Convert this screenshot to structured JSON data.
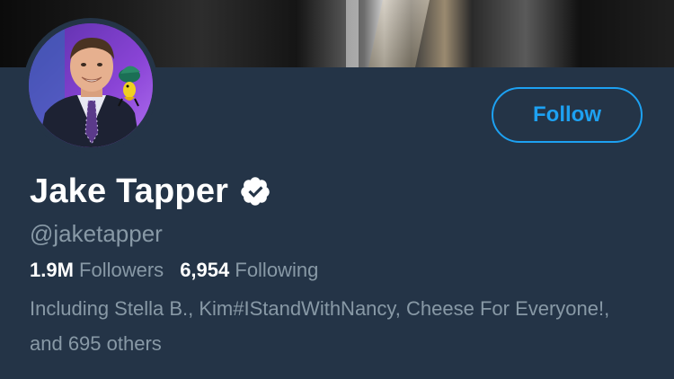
{
  "profile": {
    "name": "Jake Tapper",
    "handle": "@jaketapper",
    "follow_label": "Follow",
    "followers_count": "1.9M",
    "followers_label": "Followers",
    "following_count": "6,954",
    "following_label": "Following",
    "followed_by": "Including Stella B., Kim#IStandWithNancy, Cheese For Everyone!, and 695 others"
  },
  "icons": {
    "verified": "verified-badge-icon"
  },
  "colors": {
    "background": "#243447",
    "accent": "#1da1f2",
    "secondary_text": "#8899a6",
    "primary_text": "#ffffff"
  }
}
